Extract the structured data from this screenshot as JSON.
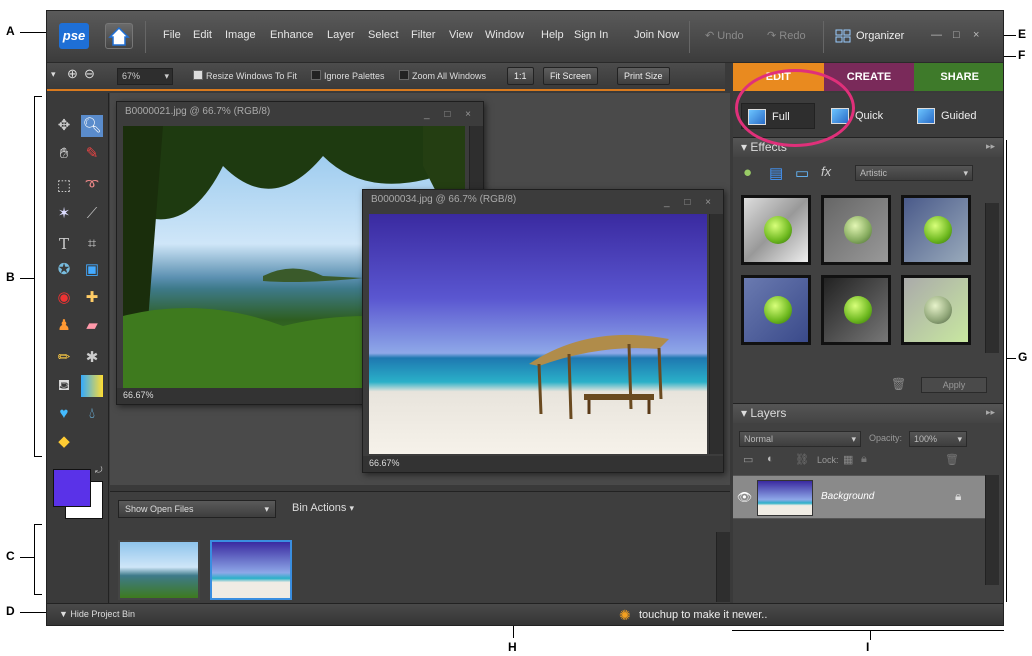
{
  "callouts": {
    "A": "A",
    "B": "B",
    "C": "C",
    "D": "D",
    "E": "E",
    "F": "F",
    "G": "G",
    "H": "H",
    "I": "I"
  },
  "app": {
    "logo": "pse",
    "menu": [
      "File",
      "Edit",
      "Image",
      "Enhance",
      "Layer",
      "Select",
      "Filter",
      "View",
      "Window",
      "Help"
    ],
    "sign_in": "Sign In",
    "join_now": "Join Now",
    "undo": "Undo",
    "redo": "Redo",
    "organizer": "Organizer"
  },
  "options": {
    "zoom": "67%",
    "resize_windows": "Resize Windows To Fit",
    "ignore_palettes": "Ignore Palettes",
    "zoom_all": "Zoom All Windows",
    "one_to_one": "1:1",
    "fit_screen": "Fit Screen",
    "print_size": "Print Size"
  },
  "tabs": {
    "edit": "EDIT",
    "create": "CREATE",
    "share": "SHARE"
  },
  "modes": {
    "full": "Full",
    "quick": "Quick",
    "guided": "Guided"
  },
  "documents": [
    {
      "title": "B0000021.jpg @ 66.7% (RGB/8)",
      "zoom": "66.67%"
    },
    {
      "title": "B0000034.jpg @ 66.7% (RGB/8)",
      "zoom": "66.67%"
    }
  ],
  "bin": {
    "show": "Show Open Files",
    "actions": "Bin Actions"
  },
  "status": {
    "hide_bin": "Hide Project Bin",
    "tip": "touchup to make it newer.."
  },
  "effects": {
    "title": "Effects",
    "category": "Artistic",
    "apply": "Apply"
  },
  "layers": {
    "title": "Layers",
    "blend": "Normal",
    "opacity_label": "Opacity:",
    "opacity": "100%",
    "lock": "Lock:",
    "layer_name": "Background"
  },
  "colors": {
    "foreground": "#5a32e8",
    "background": "#ffffff",
    "accent": "#e98a1f"
  }
}
